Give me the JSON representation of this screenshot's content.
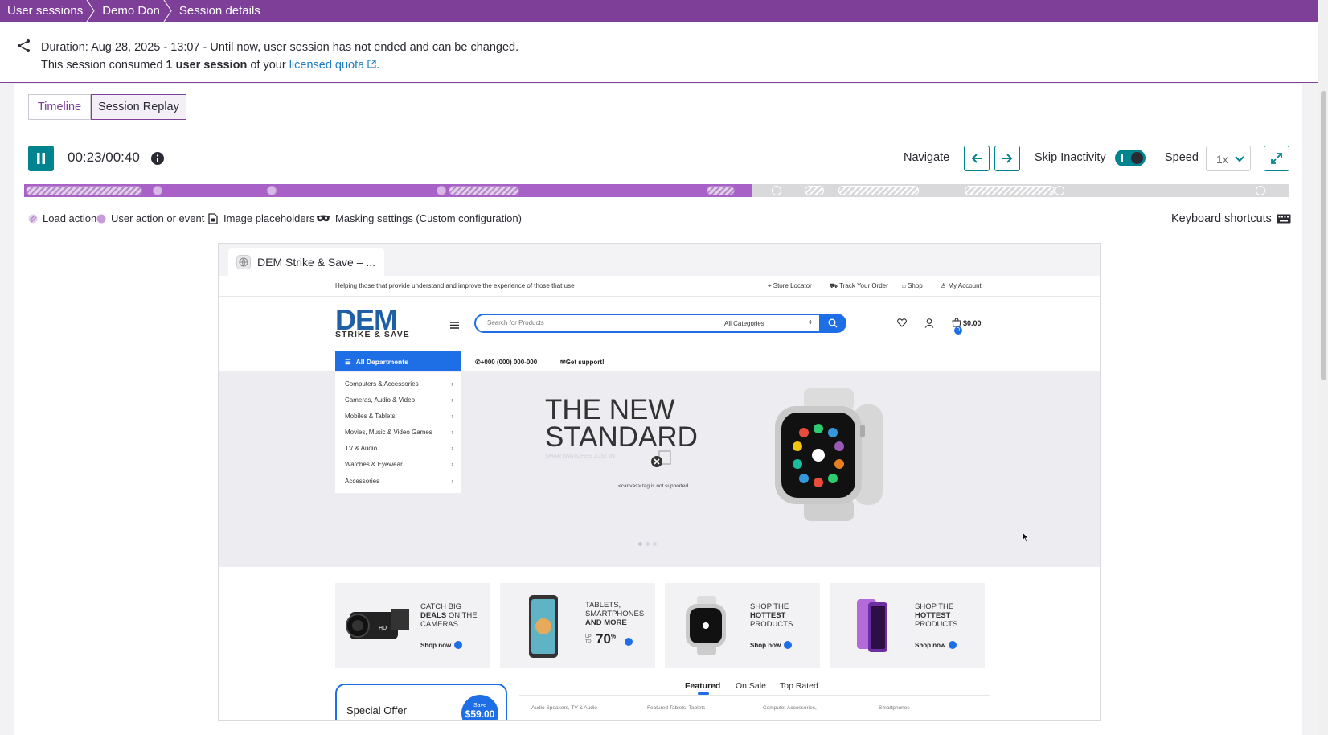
{
  "breadcrumb": [
    "User sessions",
    "Demo Don",
    "Session details"
  ],
  "info": {
    "duration_text": "Duration: Aug 28, 2025 - 13:07 - Until now, user session has not ended and can be changed.",
    "consumed_prefix": "This session consumed ",
    "consumed_bold": "1 user session",
    "consumed_mid": " of your ",
    "quota_link": "licensed quota",
    "consumed_end": "."
  },
  "tabs": [
    "Timeline",
    "Session Replay"
  ],
  "player": {
    "time": "00:23/00:40",
    "progress_fraction": 0.575,
    "navigate_label": "Navigate",
    "skip_label": "Skip Inactivity",
    "speed_label": "Speed",
    "speed_value": "1x",
    "shortcuts_label": "Keyboard shortcuts"
  },
  "legend": [
    "Load action",
    "User action or event",
    "Image placeholders",
    "Masking settings (Custom configuration)"
  ],
  "colors": {
    "brand": "#7e3f98",
    "teal": "#00848f",
    "timeline_played": "#a862c7",
    "site_blue": "#1e6ee6"
  },
  "replay": {
    "tab_title": "DEM Strike & Save – ...",
    "site": {
      "tagline": "Helping those that provide understand and improve the experience of those that use",
      "top_links": [
        "Store Locator",
        "Track Your Order",
        "Shop",
        "My Account"
      ],
      "logo_main": "DEM",
      "logo_sub": "STRIKE & SAVE",
      "search_placeholder": "Search for Products",
      "category_select": "All Categories",
      "cart_count": "0",
      "cart_total": "$0.00",
      "departments_label": "All Departments",
      "phone": "+000 (000) 000-000",
      "support": "Get support!",
      "departments": [
        "Computers & Accessories",
        "Cameras, Audio & Video",
        "Mobiles & Tablets",
        "Movies, Music & Video Games",
        "TV & Audio",
        "Watches & Eyewear",
        "Accessories"
      ],
      "hero_line1": "THE NEW",
      "hero_line2": "STANDARD",
      "hero_sub": "SMARTWATCHES JUST IN",
      "canvas_note": "<canvas> tag is not supported",
      "promos": [
        {
          "l1": "CATCH BIG",
          "l2b": "DEALS",
          "l2": " ON THE",
          "l3": "CAMERAS",
          "shop": "Shop now"
        },
        {
          "l1": "TABLETS,",
          "l2": "SMARTPHONES",
          "l3b": "AND MORE",
          "up": "UP TO",
          "pct": "70",
          "pct_sign": "%"
        },
        {
          "l1": "SHOP THE",
          "l2b": "HOTTEST",
          "l3": "PRODUCTS",
          "shop": "Shop now"
        },
        {
          "l1": "SHOP THE",
          "l2b": "HOTTEST",
          "l3": "PRODUCTS",
          "shop": "Shop now"
        }
      ],
      "special_offer": "Special Offer",
      "save_label": "Save",
      "save_amount": "$59.00",
      "product_tabs": [
        "Featured",
        "On Sale",
        "Top Rated"
      ],
      "categories": [
        "Audio Speakers, TV & Audio",
        "Featured Tablets, Tablets",
        "Computer Accessories,",
        "Smartphones"
      ]
    }
  }
}
